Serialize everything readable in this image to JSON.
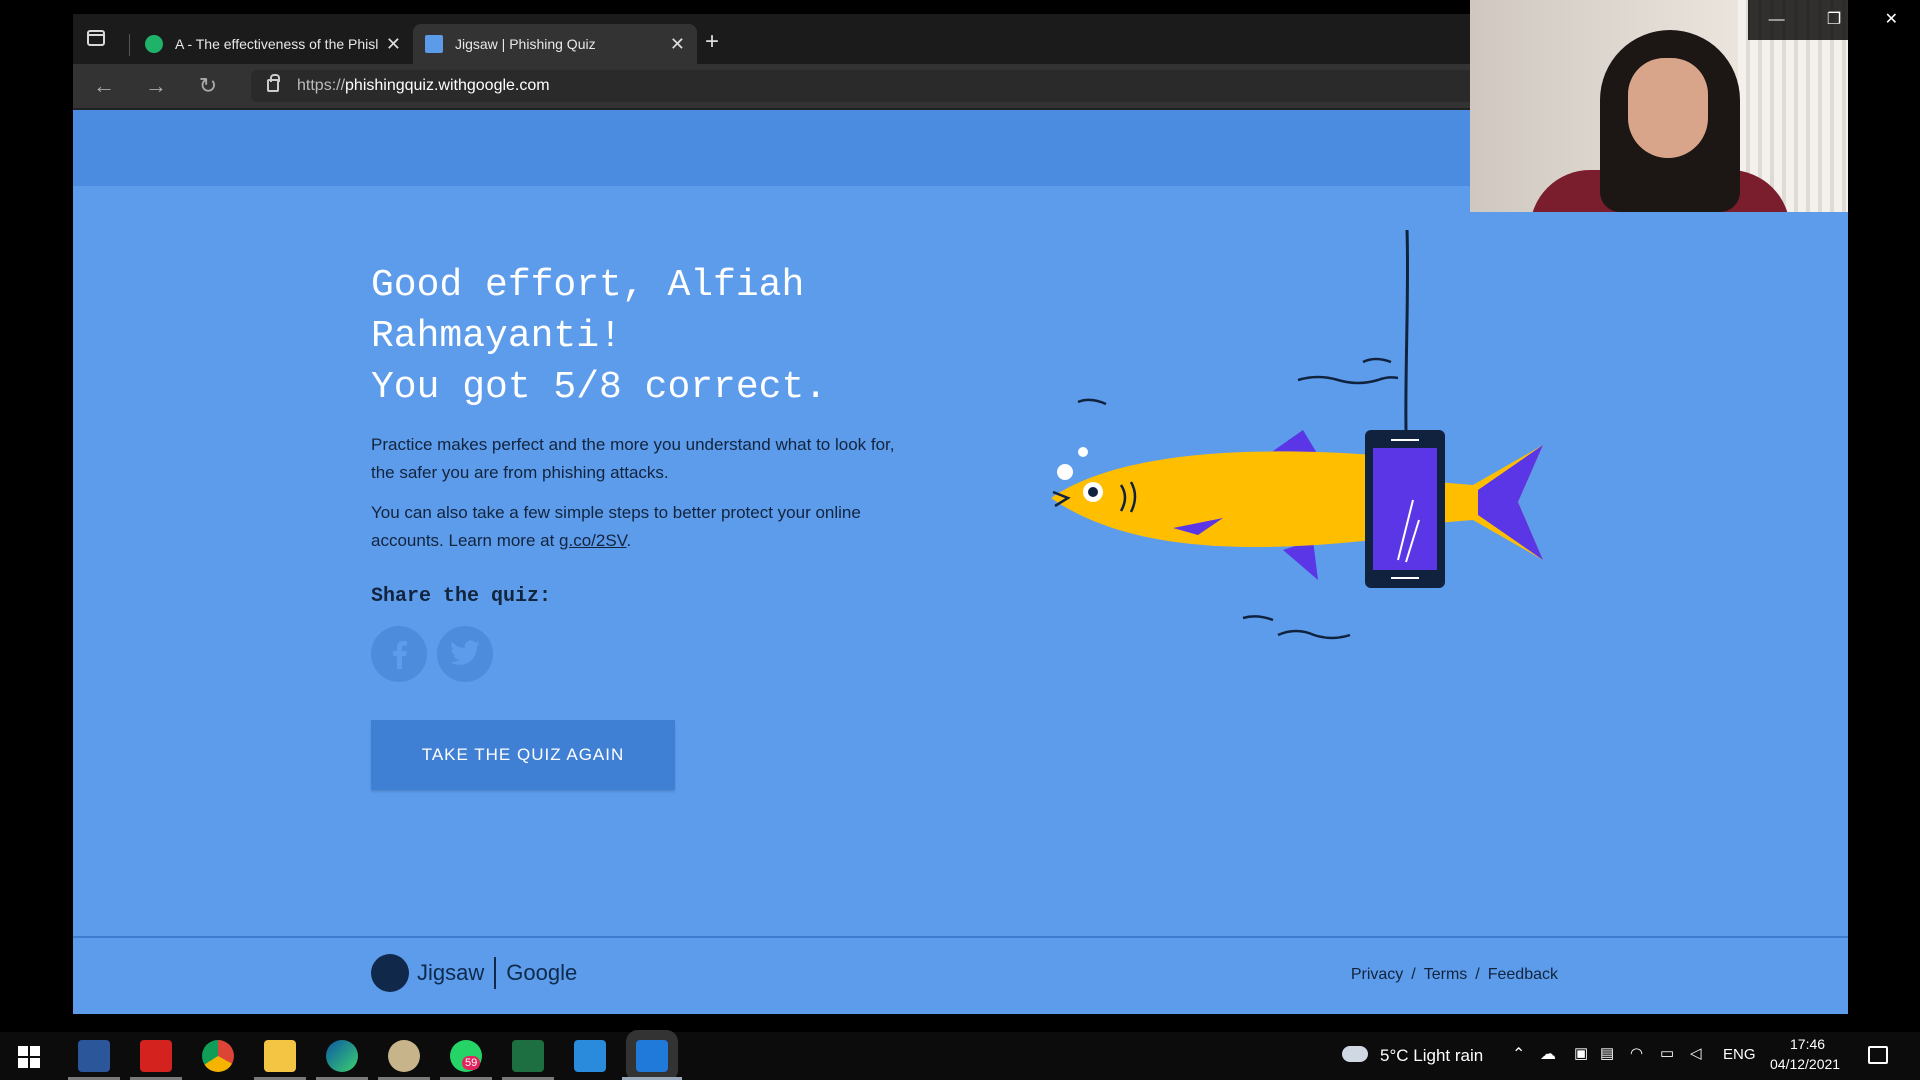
{
  "browser": {
    "tabs": [
      {
        "title": "A - The effectiveness of the Phisl",
        "close": "✕"
      },
      {
        "title": "Jigsaw | Phishing Quiz",
        "close": "✕"
      }
    ],
    "new_tab": "+",
    "url_scheme": "https://",
    "url_host": "phishingquiz.withgoogle.com"
  },
  "page": {
    "headline_line1": "Good effort, Alfiah",
    "headline_line2": "Rahmayanti!",
    "headline_line3": "You got 5/8 correct.",
    "para1": "Practice makes perfect and the more you understand what to look for, the safer you are from phishing attacks.",
    "para2_prefix": "You can also take a few simple steps to better protect your online accounts. Learn more at ",
    "para2_link": "g.co/2SV",
    "para2_suffix": ".",
    "share_title": "Share the quiz:",
    "retake_button": "TAKE THE QUIZ AGAIN"
  },
  "footer": {
    "jigsaw": "Jigsaw",
    "google": "Google",
    "links": [
      "Privacy",
      "Terms",
      "Feedback"
    ],
    "sep": "/"
  },
  "window_controls": {
    "minimize": "—",
    "restore": "❐",
    "close": "✕"
  },
  "taskbar": {
    "weather": "5°C  Light rain",
    "lang": "ENG",
    "time": "17:46",
    "date": "04/12/2021",
    "whatsapp_badge": "59"
  },
  "colors": {
    "page_bg": "#5d9ceb",
    "button": "#3f7fd4",
    "fish": "#ffbf00",
    "fin": "#5a36e6"
  }
}
